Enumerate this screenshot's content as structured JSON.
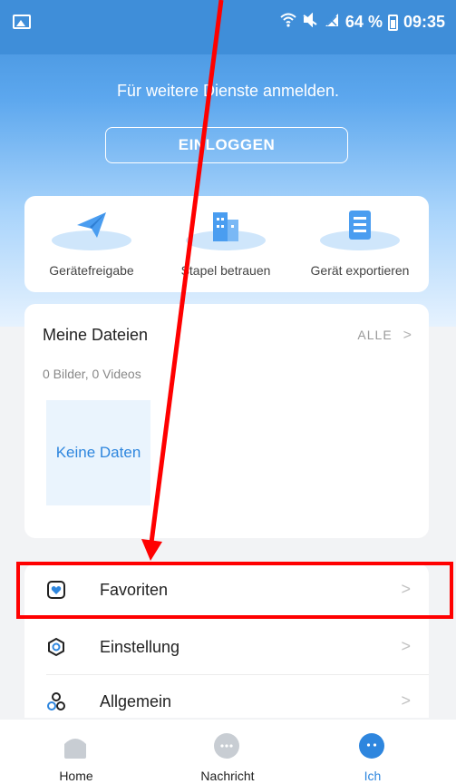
{
  "status_bar": {
    "battery_text": "64 %",
    "time": "09:35"
  },
  "header": {
    "prompt": "Für weitere Dienste anmelden.",
    "login_label": "EINLOGGEN"
  },
  "quick_actions": [
    {
      "label": "Gerätefreigabe",
      "icon": "paper-plane-icon"
    },
    {
      "label": "Stapel betrauen",
      "icon": "buildings-icon"
    },
    {
      "label": "Gerät exportieren",
      "icon": "document-list-icon"
    }
  ],
  "files": {
    "title": "Meine Dateien",
    "all_label": "ALLE",
    "count_text": "0 Bilder, 0 Videos",
    "empty_text": "Keine Daten"
  },
  "menu": [
    {
      "label": "Favoriten",
      "icon": "favorite-heart-icon"
    },
    {
      "label": "Einstellung",
      "icon": "settings-hexagon-icon"
    },
    {
      "label": "Allgemein",
      "icon": "general-circles-icon"
    }
  ],
  "tabs": [
    {
      "label": "Home",
      "icon": "home-icon",
      "active": false
    },
    {
      "label": "Nachricht",
      "icon": "message-bubble-icon",
      "active": false
    },
    {
      "label": "Ich",
      "icon": "profile-face-icon",
      "active": true
    }
  ],
  "colors": {
    "accent": "#2e86de",
    "header_blue": "#3f8ed9",
    "annotation_red": "#ff0000"
  }
}
